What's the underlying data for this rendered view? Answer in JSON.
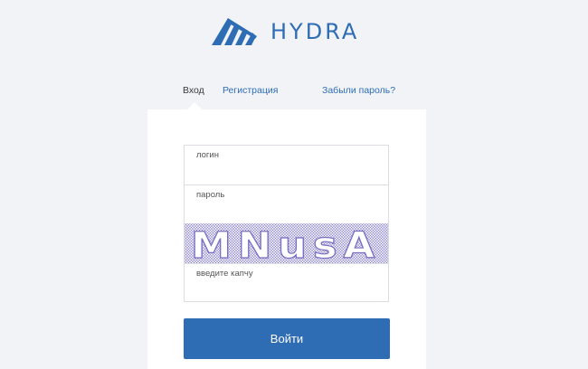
{
  "brand": {
    "name": "HYDRA",
    "logo_icon": "hydra-logo-icon",
    "color": "#2e6db4"
  },
  "tabs": {
    "login": "Вход",
    "register": "Регистрация",
    "forgot": "Забыли пароль?"
  },
  "form": {
    "login_label": "логин",
    "login_value": "",
    "password_label": "пароль",
    "password_value": "",
    "captcha_text": "MNusA",
    "captcha_label": "введите капчу",
    "captcha_value": "",
    "submit_label": "Войти"
  },
  "colors": {
    "background": "#f1f3f7",
    "accent": "#2e6db4",
    "captcha_ink": "#7a6fc2"
  }
}
